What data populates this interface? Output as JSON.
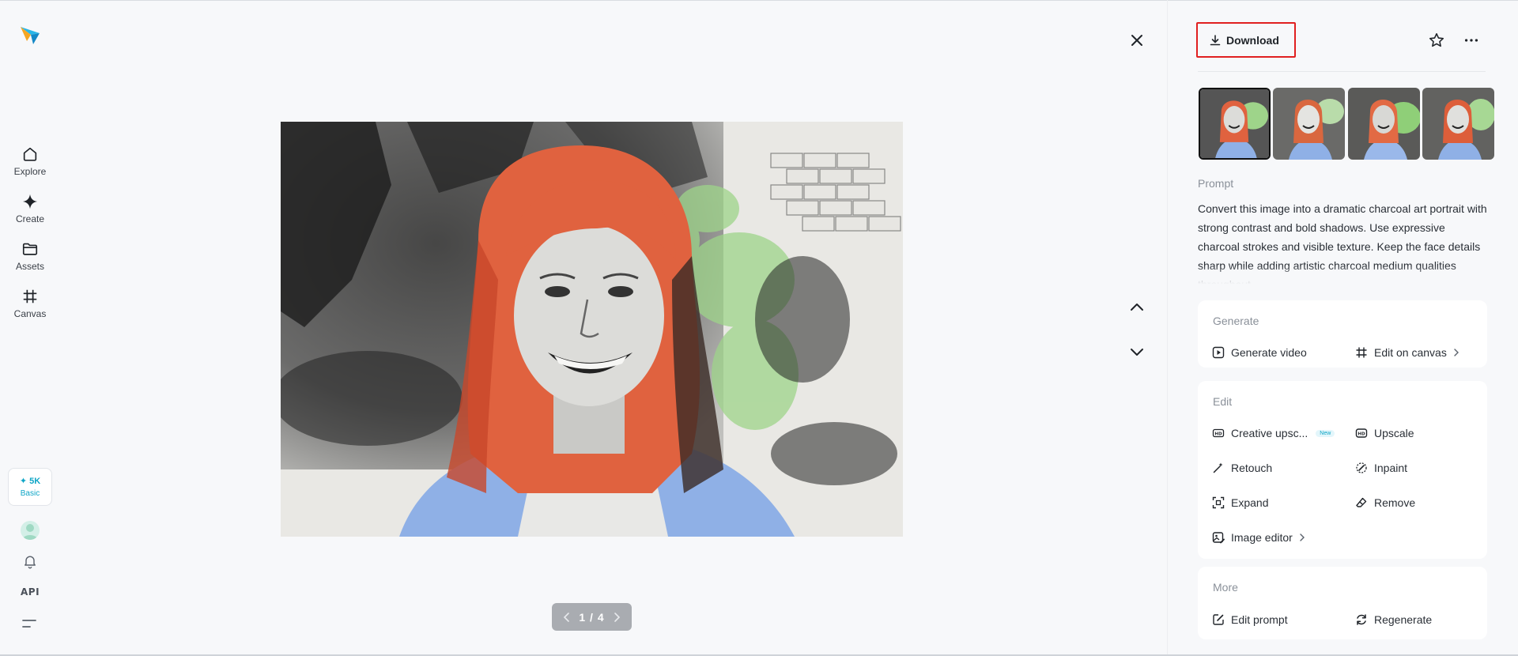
{
  "sidebar": {
    "items": [
      {
        "label": "Explore",
        "icon": "home-icon"
      },
      {
        "label": "Create",
        "icon": "sparkle-icon"
      },
      {
        "label": "Assets",
        "icon": "folder-icon"
      },
      {
        "label": "Canvas",
        "icon": "canvas-grid-icon"
      }
    ],
    "credits": {
      "amount": "✦ 5K",
      "plan": "Basic"
    },
    "api_label": "API"
  },
  "viewer": {
    "pager": {
      "current": "1",
      "separator": "/",
      "total": "4",
      "text": "1 / 4"
    }
  },
  "panel": {
    "download_label": "Download",
    "prompt_title": "Prompt",
    "prompt_text": "Convert this image into a dramatic charcoal art portrait with strong contrast and bold shadows. Use expressive charcoal strokes and visible texture. Keep the face details sharp while adding artistic charcoal medium qualities throughout.",
    "sections": {
      "generate": {
        "title": "Generate",
        "actions": [
          {
            "label": "Generate video",
            "icon": "play-square-icon"
          },
          {
            "label": "Edit on canvas",
            "icon": "canvas-grid-icon"
          }
        ]
      },
      "edit": {
        "title": "Edit",
        "actions": [
          {
            "label": "Creative upsc...",
            "icon": "hd-sparkle-icon",
            "badge": "New"
          },
          {
            "label": "Upscale",
            "icon": "hd-icon"
          },
          {
            "label": "Retouch",
            "icon": "magic-wand-icon"
          },
          {
            "label": "Inpaint",
            "icon": "inpaint-brush-icon"
          },
          {
            "label": "Expand",
            "icon": "expand-icon"
          },
          {
            "label": "Remove",
            "icon": "eraser-icon"
          },
          {
            "label": "Image editor",
            "icon": "image-edit-icon"
          }
        ]
      },
      "more": {
        "title": "More",
        "actions": [
          {
            "label": "Edit prompt",
            "icon": "edit-prompt-icon"
          },
          {
            "label": "Regenerate",
            "icon": "regenerate-icon"
          }
        ]
      }
    }
  },
  "colors": {
    "accent": "#0ea5c6",
    "highlight_border": "#e02020",
    "hair": "#e0623f",
    "shirt": "#8fb0e6",
    "foliage": "#9ed48a"
  }
}
